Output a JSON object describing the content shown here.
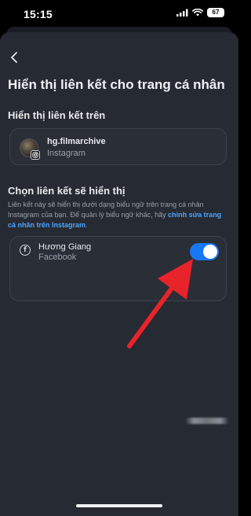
{
  "status_bar": {
    "time": "15:15",
    "battery": "67"
  },
  "header": {
    "back_icon": "chevron-left-icon",
    "title": "Hiển thị liên kết cho trang cá nhân"
  },
  "linked_on": {
    "section_title": "Hiển thị liên kết trên",
    "account": {
      "username": "hg.filmarchive",
      "platform": "Instagram",
      "platform_icon": "instagram-icon"
    }
  },
  "choose_link": {
    "section_title": "Chọn liên kết sẽ hiển thị",
    "description": "Liên kết này sẽ hiển thị dưới dạng biểu ngữ trên trang cá nhân Instagram của bạn. Để quản lý biểu ngữ khác, hãy ",
    "description_link": "chỉnh sửa trang cá nhân trên Instagram",
    "description_end": ".",
    "item": {
      "name": "Hương Giang",
      "platform": "Facebook",
      "icon": "facebook-icon",
      "toggle_on": true
    }
  },
  "colors": {
    "background": "#262a33",
    "toggle_on": "#1877f2",
    "link": "#4da3ff",
    "arrow": "#e8232a"
  }
}
